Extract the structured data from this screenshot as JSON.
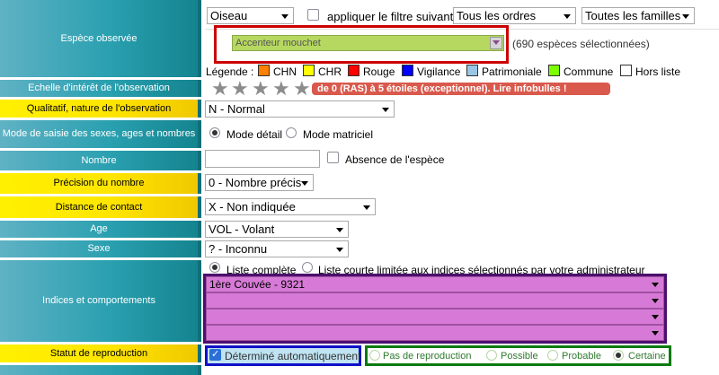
{
  "labels": {
    "espece": "Espèce observée",
    "echelle": "Echelle d'intérêt de l'observation",
    "qualitatif": "Qualitatif, nature de l'observation",
    "mode_saisie": "Mode de saisie des sexes, ages et nombres",
    "nombre": "Nombre",
    "precision": "Précision du nombre",
    "distance": "Distance de contact",
    "age": "Age",
    "sexe": "Sexe",
    "indices": "Indices et comportements",
    "statut": "Statut de reproduction"
  },
  "filters": {
    "groupe": "Oiseau",
    "filter_checkbox_label": "appliquer le filtre suivant",
    "ordres": "Tous les ordres",
    "familles": "Toutes les familles"
  },
  "species": {
    "value": "Accenteur mouchet",
    "count_text": "(690 espèces sélectionnées)"
  },
  "legend": {
    "title": "Légende :",
    "items": [
      {
        "label": "CHN",
        "color": "#ff7f00"
      },
      {
        "label": "CHR",
        "color": "#ffff00"
      },
      {
        "label": "Rouge",
        "color": "#ff0000"
      },
      {
        "label": "Vigilance",
        "color": "#0000ff"
      },
      {
        "label": "Patrimoniale",
        "color": "#9ac6e6"
      },
      {
        "label": "Commune",
        "color": "#7cff00"
      },
      {
        "label": "Hors liste",
        "color": "#ffffff"
      }
    ]
  },
  "rating": {
    "stars": 5,
    "banner": "de 0 (RAS) à 5 étoiles (exceptionnel). Lire infobulles !"
  },
  "qualitatif_value": "N - Normal",
  "mode": {
    "detail": "Mode détail",
    "matriciel": "Mode matriciel",
    "selected": "detail"
  },
  "nombre": {
    "value": "",
    "absence_label": "Absence de l'espèce"
  },
  "precision_value": "0 - Nombre précis",
  "distance_value": "X - Non indiquée",
  "age_value": "VOL - Volant",
  "sexe_value": "? - Inconnu",
  "indices": {
    "list_complete": "Liste complète",
    "list_courte": "Liste courte limitée aux indices sélectionnés par votre administrateur",
    "rows": [
      "1ère Couvée - 9321",
      "",
      "",
      ""
    ]
  },
  "statut": {
    "auto_label": "Déterminé automatiquement",
    "options": [
      "Pas de reproduction",
      "Possible",
      "Probable",
      "Certaine"
    ],
    "selected": "Certaine"
  },
  "highlight_colors": {
    "red_box": "#cc0000",
    "purple_box": "#4b0f6e",
    "blue_box": "#1010c8",
    "green_box": "#0a7a10",
    "indices_bg": "#d77ad7",
    "species_bg": "#b6d860",
    "banner_bg": "#d9594c"
  }
}
